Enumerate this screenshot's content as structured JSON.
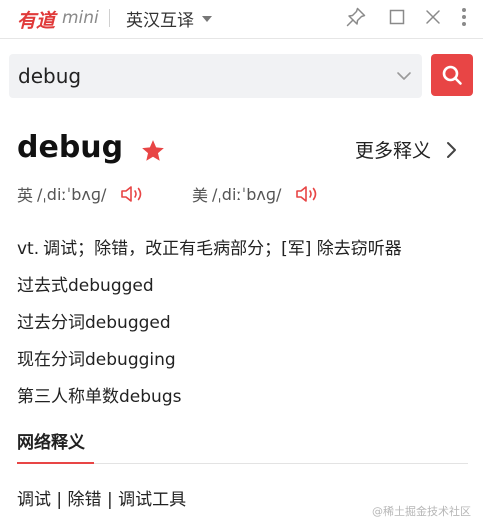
{
  "titlebar": {
    "brand": "有道",
    "brand_sub": "mini",
    "language_mode": "英汉互译",
    "brand_color": "#e03a3a",
    "icons": [
      "pin-icon",
      "maximize-icon",
      "close-icon",
      "more-vertical-icon"
    ]
  },
  "search": {
    "value": "debug",
    "placeholder": "",
    "button_color": "#e84545",
    "button_icon": "search-icon"
  },
  "entry": {
    "word": "debug",
    "favorite": true,
    "more_label": "更多释义",
    "phonetics": [
      {
        "region": "英",
        "text": "/ˌdiːˈbʌɡ/"
      },
      {
        "region": "美",
        "text": "/ˌdiːˈbʌɡ/"
      }
    ],
    "definitions": [
      {
        "pos": "vt.",
        "text": "调试；除错，改正有毛病部分；[军] 除去窃听器"
      }
    ],
    "forms": [
      "过去式debugged",
      "过去分词debugged",
      "现在分词debugging",
      "第三人称单数debugs"
    ]
  },
  "web": {
    "title": "网络释义",
    "definitions": "调试 | 除错 | 调试工具"
  },
  "watermark": "@稀土掘金技术社区",
  "accent_color": "#e84545"
}
